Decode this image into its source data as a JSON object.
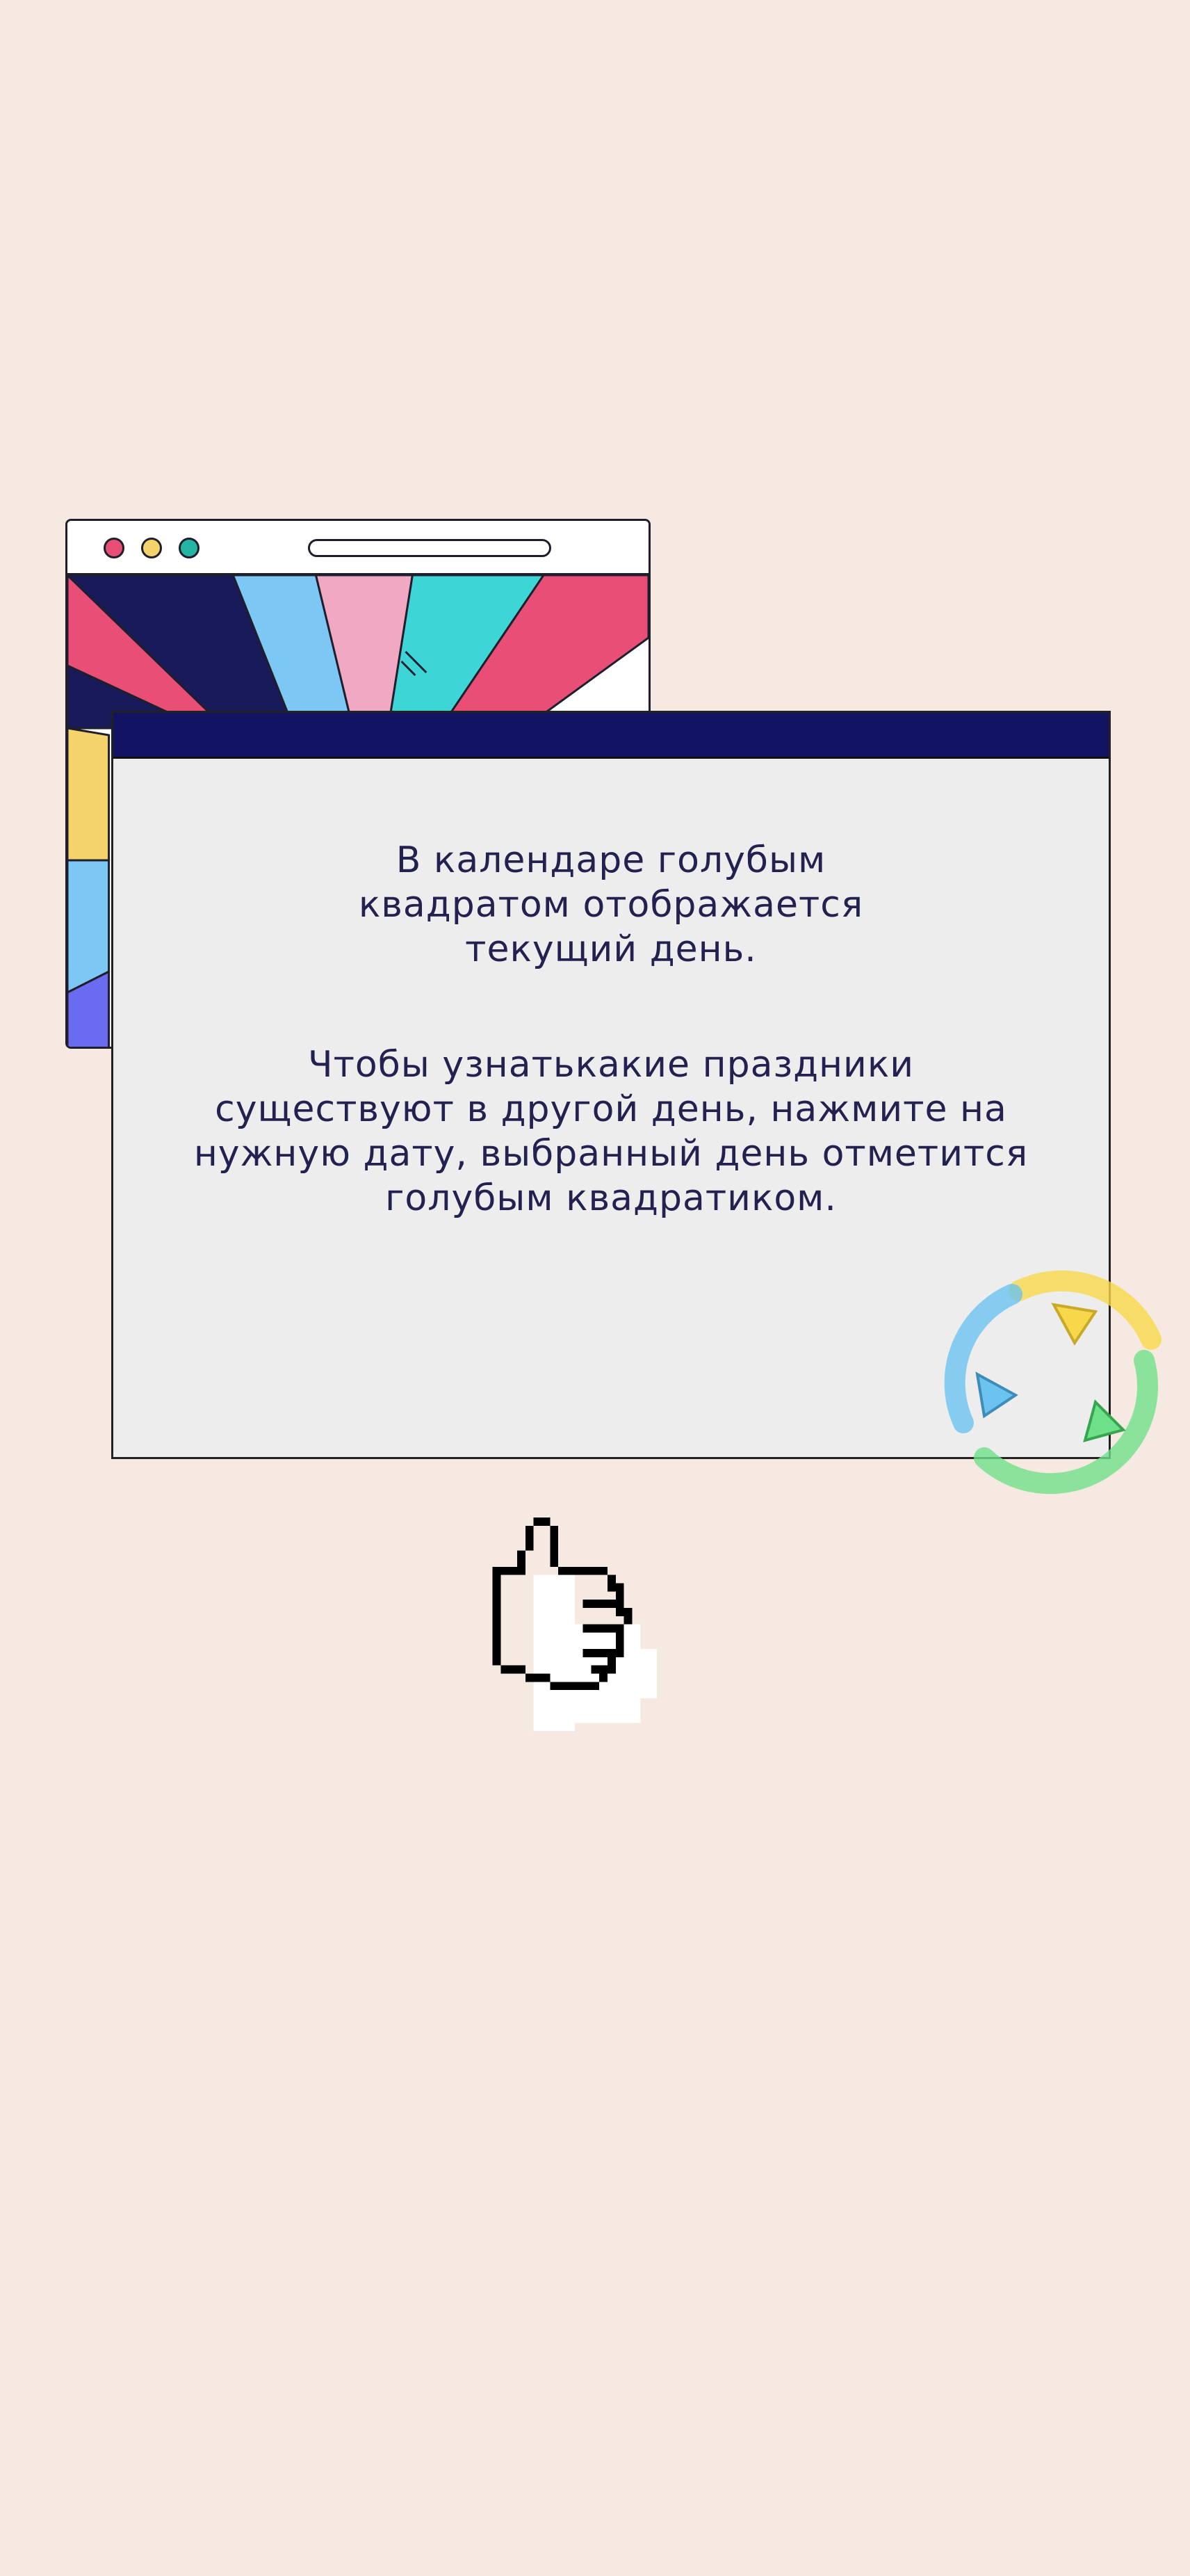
{
  "background_color": "#F5E9E1",
  "back_window": {
    "traffic_lights": [
      "#E94E77",
      "#F4D36B",
      "#27B3A2"
    ],
    "ray_colors": [
      "#E94E77",
      "#191A59",
      "#7DC7F5",
      "#F0A8C3",
      "#3ED5D7",
      "#F4D36B",
      "#6B6BF2"
    ]
  },
  "popup": {
    "titlebar_color": "#131364",
    "body_color": "#EEEDED",
    "text_color": "#23214F",
    "paragraph_1": "В календаре голубым квадратом отображается текущий день.",
    "paragraph_2": "Чтобы узнатькакие праздники существуют в другой день, нажмите на нужную дату, выбранный день отметится голубым квадратиком."
  },
  "logo": {
    "icon": "tricolor-triangles-logo-icon",
    "colors": [
      "#F7D84A",
      "#6CC3F0",
      "#6FE08A"
    ]
  },
  "cursor": {
    "icon": "thumbs-up-hand-cursor-icon"
  }
}
